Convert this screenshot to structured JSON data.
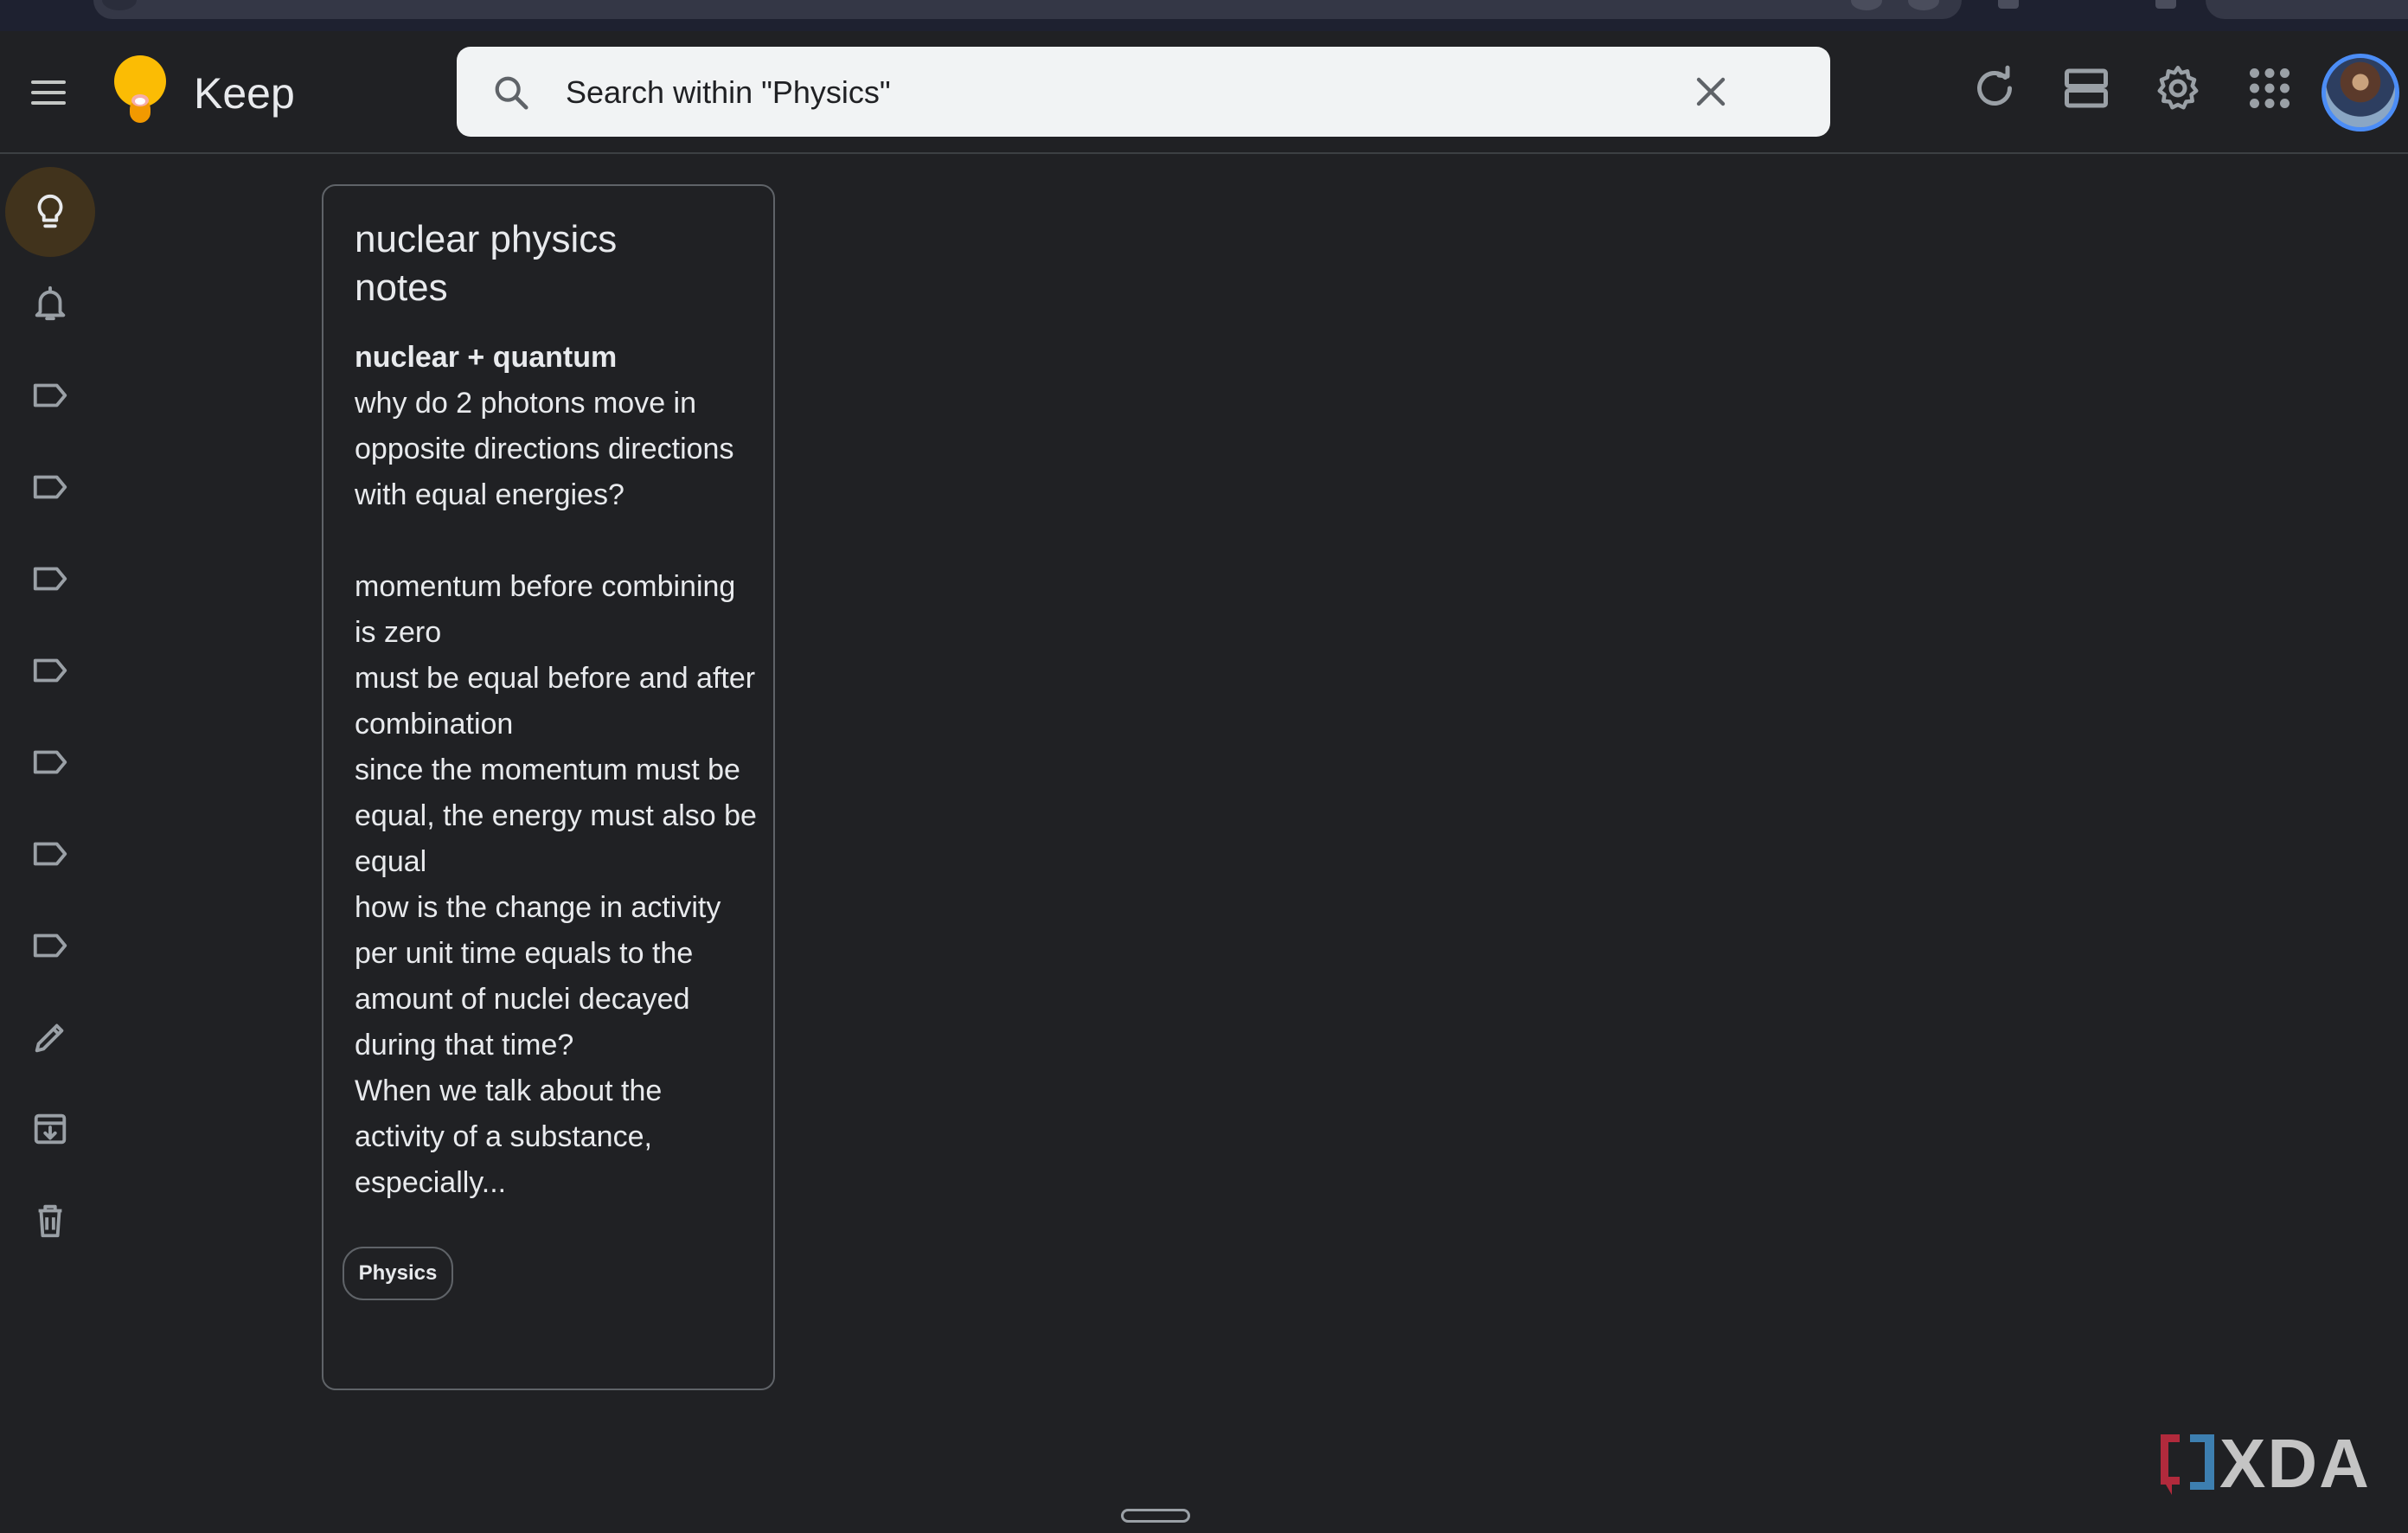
{
  "app": {
    "title": "Keep"
  },
  "search": {
    "placeholder": "Search within \"Physics\"",
    "value": ""
  },
  "header_icons": [
    "refresh-icon",
    "list-view-icon",
    "settings-icon",
    "apps-icon"
  ],
  "sidebar": {
    "items": [
      {
        "icon": "lightbulb-icon",
        "active": true
      },
      {
        "icon": "bell-icon"
      },
      {
        "icon": "label-icon"
      },
      {
        "icon": "label-icon"
      },
      {
        "icon": "label-icon"
      },
      {
        "icon": "label-icon"
      },
      {
        "icon": "label-icon"
      },
      {
        "icon": "label-icon"
      },
      {
        "icon": "label-icon"
      },
      {
        "icon": "pencil-icon"
      },
      {
        "icon": "archive-icon"
      },
      {
        "icon": "trash-icon"
      }
    ]
  },
  "note": {
    "title_line1": "nuclear physics",
    "title_line2": "notes",
    "heading": "nuclear + quantum",
    "lines": [
      "why do 2 photons move in",
      "opposite directions directions",
      "with equal energies?"
    ],
    "lines2": [
      "momentum before combining",
      "is zero",
      "must be equal before and after",
      "combination",
      "since the momentum must be",
      "equal, the energy must also be",
      "equal",
      "how is the change in activity",
      "per unit time equals to the",
      "amount of nuclei decayed",
      "during that time?",
      "When we talk about the",
      "activity of a substance,",
      "especially..."
    ],
    "label": "Physics"
  },
  "watermark": {
    "text": "XDA"
  },
  "colors": {
    "background": "#202124",
    "accent_active": "#41331c",
    "search_bg": "#f1f3f4",
    "avatar_ring": "#4c8df6"
  }
}
